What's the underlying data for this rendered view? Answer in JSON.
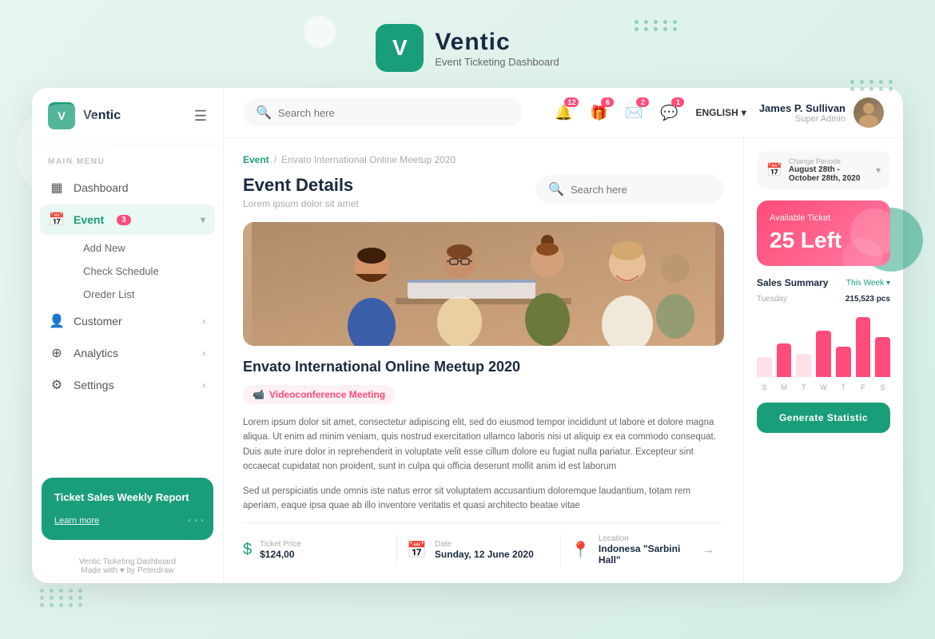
{
  "app": {
    "name": "Ventic",
    "tagline": "Event Ticketing Dashboard",
    "logo_letter": "V"
  },
  "topbar": {
    "search_placeholder": "Search here",
    "language": "ENGLISH",
    "user": {
      "name": "James P. Sullivan",
      "role": "Super Admin"
    },
    "notifications": {
      "bell": "12",
      "gift": "6",
      "mail": "2",
      "chat": "1"
    }
  },
  "sidebar": {
    "logo": "V",
    "brand": "Ventic",
    "section_label": "MAIN MENU",
    "nav_items": [
      {
        "id": "dashboard",
        "label": "Dashboard",
        "icon": "▦",
        "active": false
      },
      {
        "id": "event",
        "label": "Event",
        "icon": "📅",
        "active": true,
        "badge": "3"
      },
      {
        "id": "customer",
        "label": "Customer",
        "icon": "👤",
        "active": false
      },
      {
        "id": "analytics",
        "label": "Analytics",
        "icon": "➕",
        "active": false
      },
      {
        "id": "settings",
        "label": "Settings",
        "icon": "⚙",
        "active": false
      }
    ],
    "event_sub": [
      "Add New",
      "Check Schedule",
      "Oreder List"
    ],
    "card": {
      "title": "Ticket Sales Weekly Report",
      "link": "Learn more"
    },
    "footer": "Ventic Ticketing Dashboard",
    "footer_sub": "Made with ♥ by Peterdraw"
  },
  "breadcrumb": {
    "parent": "Event",
    "separator": "/",
    "current": "Envato International Online Meetup 2020"
  },
  "page": {
    "title": "Event Details",
    "subtitle": "Lorem ipsum  dolor sit amet",
    "search_placeholder": "Search here"
  },
  "event": {
    "title": "Envato International Online Meetup 2020",
    "tag": "Videoconference Meeting",
    "description_1": "Lorem ipsum dolor sit amet, consectetur adipiscing elit, sed do eiusmod tempor incididunt ut labore et dolore magna aliqua. Ut enim ad minim veniam, quis nostrud exercitation ullamco laboris nisi ut aliquip ex ea commodo consequat. Duis aute irure dolor in reprehenderit in voluptate velit esse cillum dolore eu fugiat nulla pariatur. Excepteur sint occaecat cupidatat non proident, sunt in culpa qui officia deserunt mollit anim id est laborum",
    "description_2": "Sed ut perspiciatis unde omnis iste natus error sit voluptatem accusantium doloremque laudantium, totam rem aperiam, eaque ipsa quae ab illo inventore veritatis et quasi architecto beatae vitae",
    "ticket_price_label": "Ticket Price",
    "ticket_price": "$124,00",
    "date_label": "Date",
    "date": "Sunday, 12 June 2020",
    "location_label": "Location",
    "location": "Indonesa \"Sarbini Hall\""
  },
  "right_panel": {
    "period_label": "Change Periode",
    "period_value": "August 28th - October 28th, 2020",
    "ticket": {
      "label": "Available Ticket",
      "count": "25 Left"
    },
    "sales_summary": {
      "title": "Sales Summary",
      "period": "This Week",
      "day": "Tuesday",
      "amount": "215,523 pcs",
      "chart_bars": [
        30,
        50,
        35,
        70,
        45,
        90,
        60
      ],
      "chart_labels": [
        "S",
        "M",
        "T",
        "W",
        "T",
        "F",
        "S"
      ],
      "chart_active": [
        false,
        false,
        false,
        false,
        false,
        true,
        false
      ]
    },
    "generate_btn": "Generate Statistic"
  }
}
